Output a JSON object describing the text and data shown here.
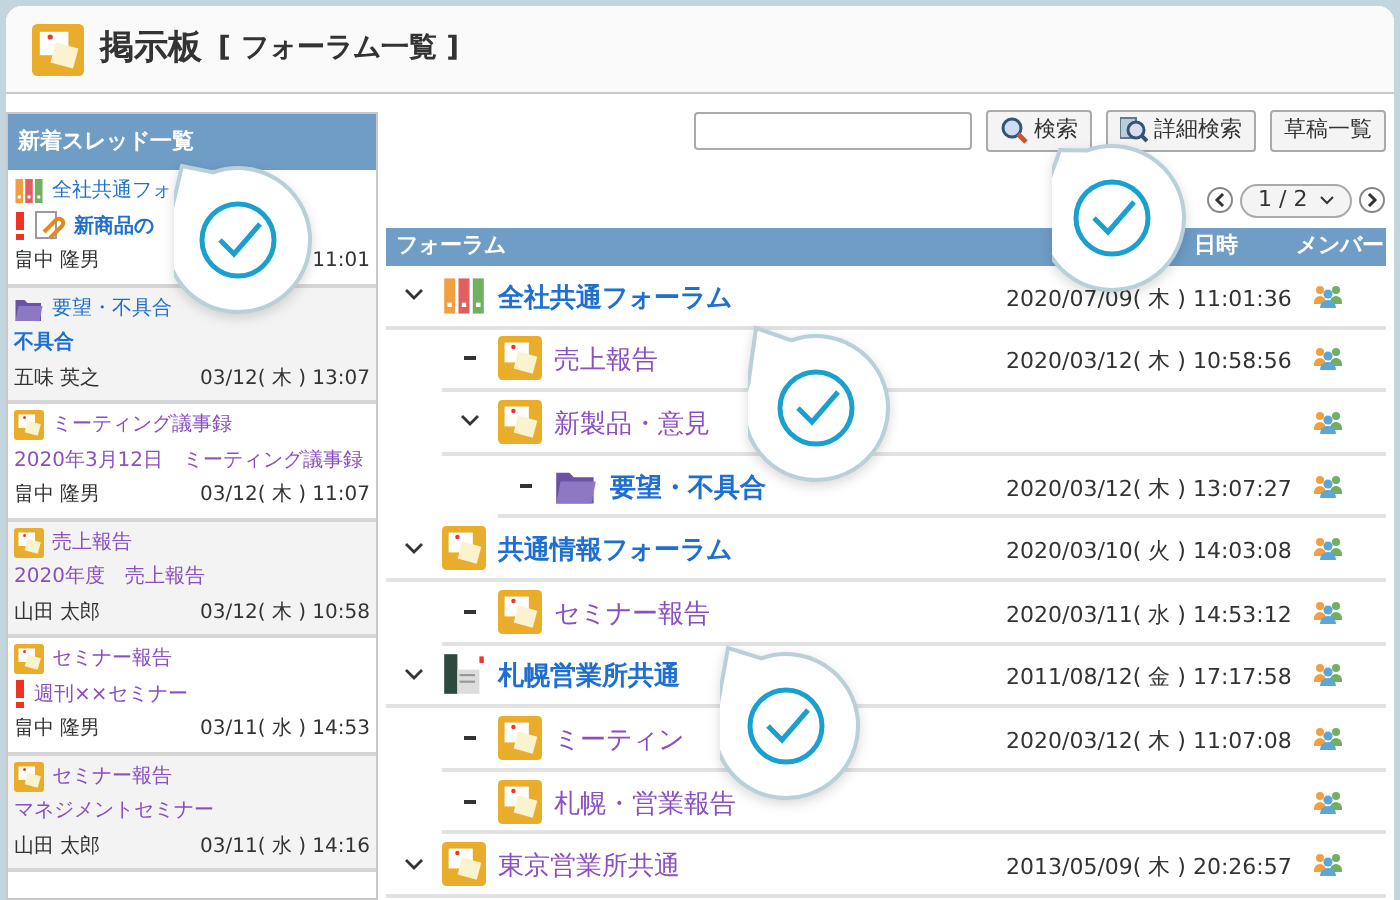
{
  "window": {
    "title": "掲示板",
    "subtitle": "[ フォーラム一覧 ]"
  },
  "sidebar": {
    "title": "新着スレッド一覧",
    "items": [
      {
        "forum": "全社共通フォ",
        "kind": "binders",
        "unread": true,
        "important": true,
        "attachment": true,
        "title": "新商品の",
        "author": "畠中 隆男",
        "date": "11:01"
      },
      {
        "forum": "要望・不具合",
        "kind": "folder",
        "unread": true,
        "important": false,
        "attachment": false,
        "title": "不具合",
        "author": "五味 英之",
        "date": "03/12( 木 ) 13:07"
      },
      {
        "forum": "ミーティング議事録",
        "kind": "board",
        "unread": false,
        "important": false,
        "attachment": false,
        "title": "2020年3月12日　ミーティング議事録",
        "author": "畠中 隆男",
        "date": "03/12( 木 ) 11:07"
      },
      {
        "forum": "売上報告",
        "kind": "board",
        "unread": false,
        "important": false,
        "attachment": false,
        "title": "2020年度　売上報告",
        "author": "山田 太郎",
        "date": "03/12( 木 ) 10:58"
      },
      {
        "forum": "セミナー報告",
        "kind": "board",
        "unread": false,
        "important": true,
        "attachment": false,
        "title": "週刊××セミナー",
        "author": "畠中 隆男",
        "date": "03/11( 水 ) 14:53"
      },
      {
        "forum": "セミナー報告",
        "kind": "board",
        "unread": false,
        "important": false,
        "attachment": false,
        "title": "マネジメントセミナー",
        "author": "山田 太郎",
        "date": "03/11( 水 ) 14:16"
      }
    ]
  },
  "search": {
    "buttons": [
      "検索",
      "詳細検索",
      "草稿一覧"
    ]
  },
  "pager": {
    "value": "1 / 2"
  },
  "table": {
    "columns": [
      "フォーラム",
      "日時",
      "メンバー"
    ],
    "rows": [
      {
        "name": "全社共通フォーラム",
        "kind": "binders",
        "unread": true,
        "expanded": true,
        "date": "2020/07/09( 木 ) 11:01:36",
        "children": [
          {
            "name": "売上報告",
            "kind": "board",
            "unread": false,
            "expanded": false,
            "date": "2020/03/12( 木 ) 10:58:56"
          },
          {
            "name": "新製品・意見",
            "kind": "board",
            "unread": false,
            "expanded": true,
            "children": [
              {
                "name": "要望・不具合",
                "kind": "folder",
                "unread": true,
                "expanded": false,
                "date": "2020/03/12( 木 ) 13:07:27"
              }
            ]
          }
        ]
      },
      {
        "name": "共通情報フォーラム",
        "kind": "board",
        "unread": true,
        "expanded": true,
        "date": "2020/03/10( 火 ) 14:03:08",
        "children": [
          {
            "name": "セミナー報告",
            "kind": "board",
            "unread": false,
            "expanded": false,
            "date": "2020/03/11( 水 ) 14:53:12"
          }
        ]
      },
      {
        "name": "札幌営業所共通",
        "kind": "office",
        "unread": true,
        "expanded": true,
        "date": "2011/08/12( 金 ) 17:17:58",
        "children": [
          {
            "name": "ミーティン",
            "kind": "board",
            "unread": false,
            "expanded": false,
            "date": "2020/03/12( 木 ) 11:07:08"
          },
          {
            "name": "札幌・営業報告",
            "kind": "board",
            "unread": false,
            "expanded": false
          }
        ]
      },
      {
        "name": "東京営業所共通",
        "kind": "board",
        "unread": false,
        "expanded": true,
        "date": "2013/05/09( 木 ) 20:26:57"
      }
    ]
  }
}
